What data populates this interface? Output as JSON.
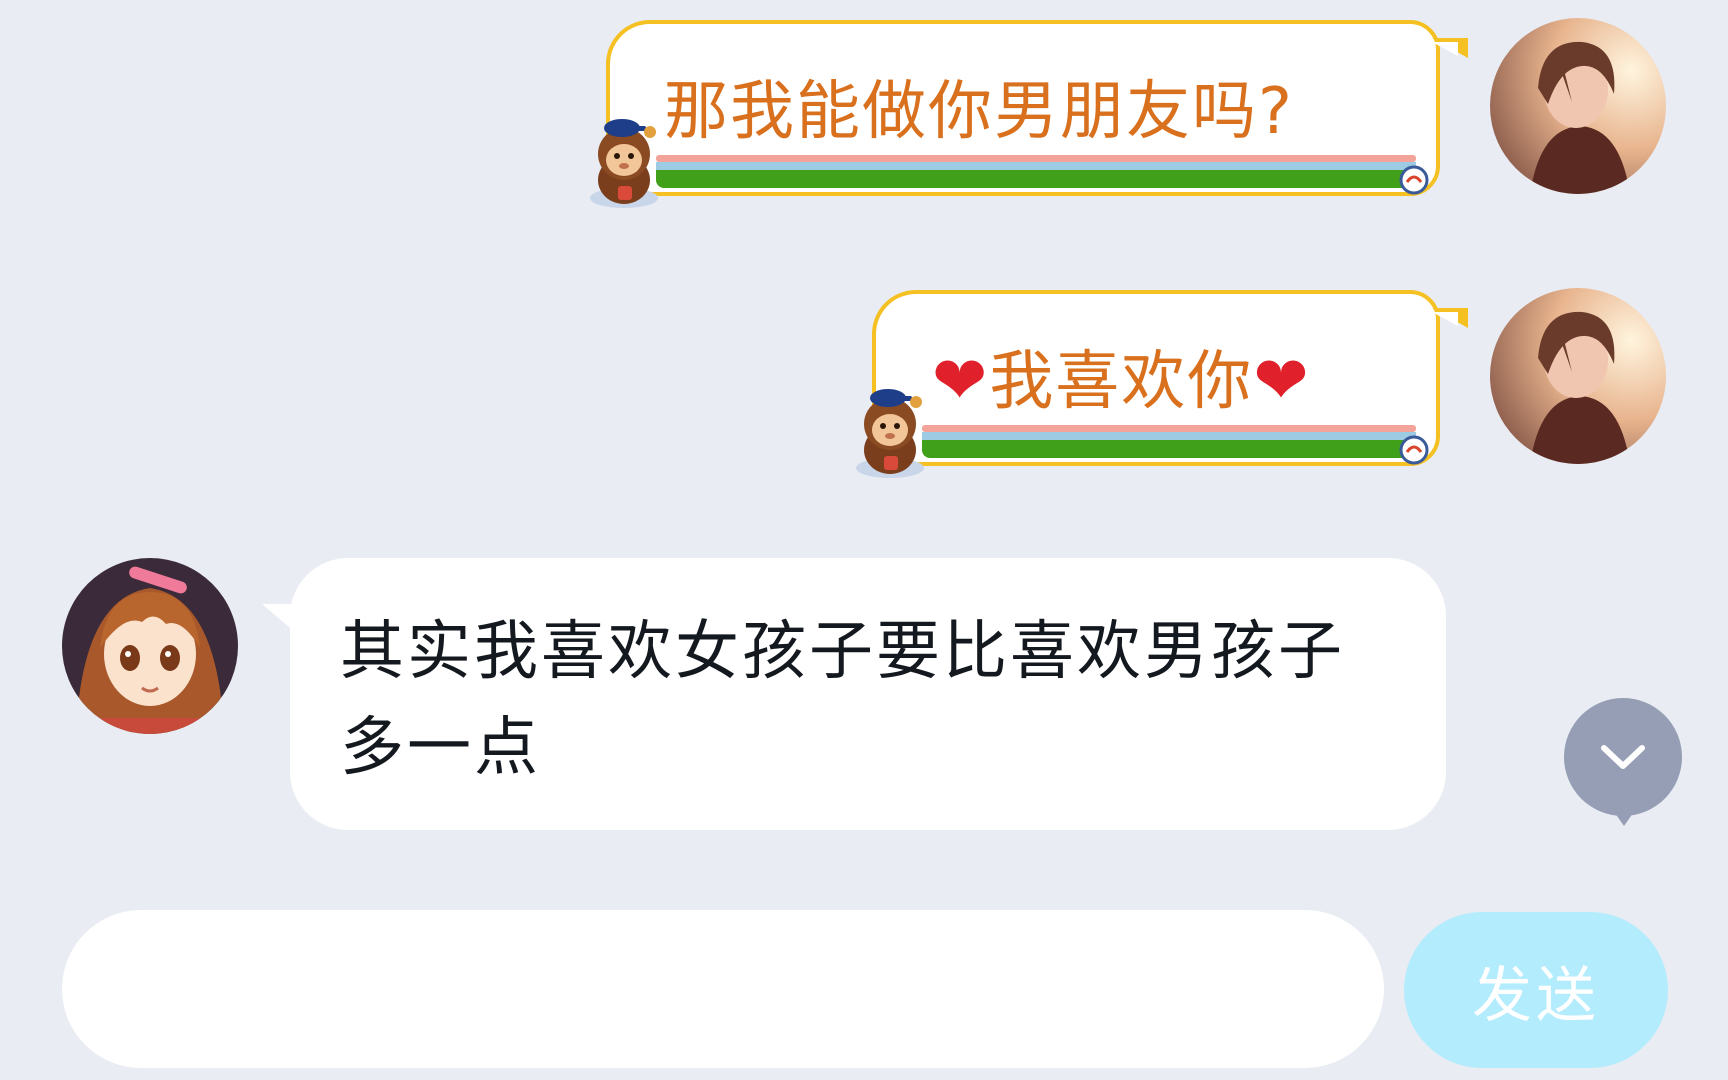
{
  "messages": [
    {
      "side": "right",
      "text": "那我能做你男朋友吗?"
    },
    {
      "side": "right",
      "heart_left": "❤",
      "text": "我喜欢你",
      "heart_right": "❤"
    },
    {
      "side": "left",
      "text": "其实我喜欢女孩子要比喜欢男孩子多一点"
    }
  ],
  "composer": {
    "input_value": "",
    "input_placeholder": "",
    "send_label": "发送"
  },
  "colors": {
    "background": "#e9ecf3",
    "sent_text": "#d9701e",
    "bubble_border": "#f5c022",
    "send_button": "#b3ecfd",
    "scroll_button": "#959eb4"
  },
  "icons": {
    "scroll_down": "chevron-down-icon",
    "mascot": "monkey-mascot-icon"
  }
}
